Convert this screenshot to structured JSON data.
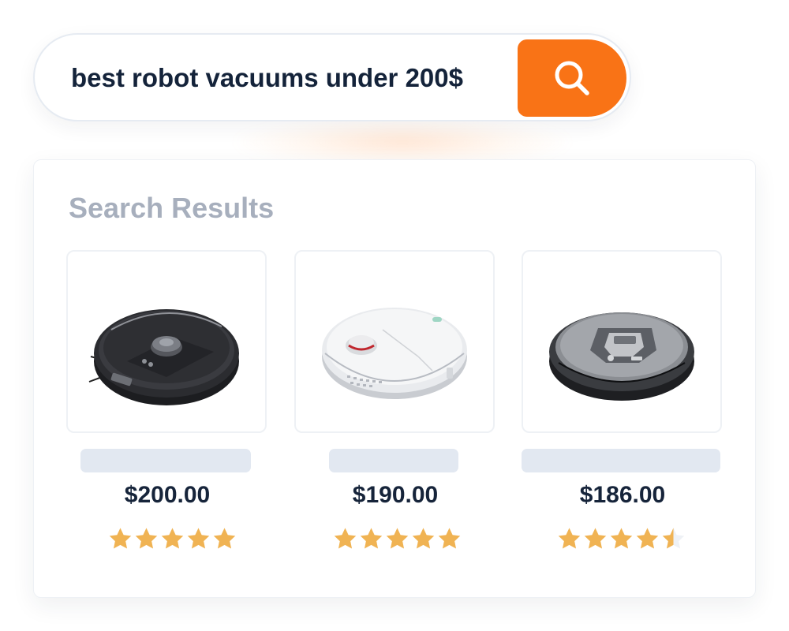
{
  "search": {
    "value": "best robot vacuums under 200$",
    "button_icon": "search-icon"
  },
  "results": {
    "heading": "Search Results",
    "products": [
      {
        "image": "black-robot-vacuum-image",
        "price": "$200.00",
        "rating": 5
      },
      {
        "image": "white-robot-vacuum-image",
        "price": "$190.00",
        "rating": 5
      },
      {
        "image": "gray-robot-vacuum-image",
        "price": "$186.00",
        "rating": 4.5
      }
    ]
  },
  "colors": {
    "accent": "#f97316",
    "star": "#f0b353",
    "star_empty": "#eef1f5",
    "heading": "#a7afbd",
    "price": "#16243a"
  }
}
